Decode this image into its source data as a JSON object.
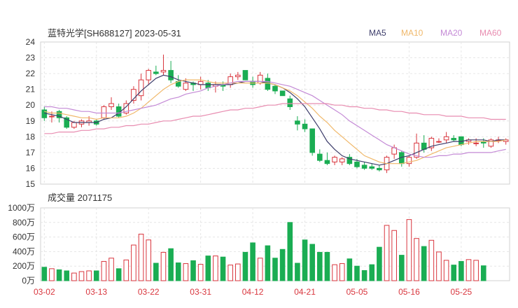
{
  "title": "蓝特光学[SH688127] 2023-05-31",
  "volume_title": "成交量 2071175",
  "colors": {
    "up": "#d9363e",
    "down": "#1aad53",
    "ma5": "#3d3d6b",
    "ma10": "#f0b86a",
    "ma20": "#c48ad6",
    "ma60": "#e88cb0"
  },
  "chart_data": [
    {
      "type": "candlestick",
      "title": "蓝特光学[SH688127] 2023-05-31",
      "ylim": [
        15,
        24
      ],
      "yticks": [
        15,
        16,
        17,
        18,
        19,
        20,
        21,
        22,
        23,
        24
      ],
      "x_labels": [
        "03-02",
        "03-13",
        "03-22",
        "03-31",
        "04-12",
        "04-21",
        "05-05",
        "05-16",
        "05-25"
      ],
      "x_label_index": [
        0,
        7,
        14,
        21,
        28,
        35,
        42,
        49,
        56
      ],
      "legend": [
        "MA5",
        "MA10",
        "MA20",
        "MA60"
      ],
      "candles": [
        {
          "o": 19.7,
          "h": 19.9,
          "l": 19.0,
          "c": 19.2
        },
        {
          "o": 19.3,
          "h": 19.6,
          "l": 18.9,
          "c": 19.3
        },
        {
          "o": 19.6,
          "h": 19.7,
          "l": 18.9,
          "c": 19.2
        },
        {
          "o": 19.2,
          "h": 19.3,
          "l": 18.5,
          "c": 18.6
        },
        {
          "o": 18.6,
          "h": 19.0,
          "l": 18.5,
          "c": 18.9
        },
        {
          "o": 18.8,
          "h": 19.1,
          "l": 18.6,
          "c": 19.0
        },
        {
          "o": 18.9,
          "h": 19.3,
          "l": 18.7,
          "c": 19.0
        },
        {
          "o": 19.0,
          "h": 19.1,
          "l": 18.7,
          "c": 18.8
        },
        {
          "o": 19.2,
          "h": 20.0,
          "l": 19.1,
          "c": 19.9
        },
        {
          "o": 19.9,
          "h": 20.5,
          "l": 19.7,
          "c": 20.1
        },
        {
          "o": 19.9,
          "h": 20.1,
          "l": 19.2,
          "c": 19.3
        },
        {
          "o": 19.5,
          "h": 20.3,
          "l": 19.4,
          "c": 20.1
        },
        {
          "o": 20.3,
          "h": 21.2,
          "l": 20.1,
          "c": 21.0
        },
        {
          "o": 20.6,
          "h": 22.0,
          "l": 20.3,
          "c": 21.6
        },
        {
          "o": 21.6,
          "h": 22.3,
          "l": 21.3,
          "c": 22.2
        },
        {
          "o": 22.1,
          "h": 22.5,
          "l": 21.9,
          "c": 22.0
        },
        {
          "o": 22.1,
          "h": 23.2,
          "l": 21.9,
          "c": 22.2
        },
        {
          "o": 22.2,
          "h": 22.8,
          "l": 21.4,
          "c": 21.6
        },
        {
          "o": 21.5,
          "h": 21.9,
          "l": 21.1,
          "c": 21.2
        },
        {
          "o": 21.0,
          "h": 21.7,
          "l": 20.9,
          "c": 21.4
        },
        {
          "o": 21.4,
          "h": 21.5,
          "l": 20.9,
          "c": 21.3
        },
        {
          "o": 21.3,
          "h": 21.8,
          "l": 21.0,
          "c": 21.5
        },
        {
          "o": 21.4,
          "h": 21.6,
          "l": 20.9,
          "c": 21.1
        },
        {
          "o": 21.2,
          "h": 21.5,
          "l": 20.8,
          "c": 21.3
        },
        {
          "o": 21.3,
          "h": 21.5,
          "l": 20.9,
          "c": 21.2
        },
        {
          "o": 21.3,
          "h": 22.0,
          "l": 21.1,
          "c": 21.8
        },
        {
          "o": 21.8,
          "h": 22.1,
          "l": 21.6,
          "c": 21.9
        },
        {
          "o": 22.2,
          "h": 22.2,
          "l": 21.6,
          "c": 21.6
        },
        {
          "o": 21.5,
          "h": 21.8,
          "l": 21.1,
          "c": 21.3
        },
        {
          "o": 21.4,
          "h": 22.1,
          "l": 21.3,
          "c": 21.9
        },
        {
          "o": 21.7,
          "h": 22.0,
          "l": 20.9,
          "c": 21.0
        },
        {
          "o": 21.2,
          "h": 21.3,
          "l": 20.7,
          "c": 20.9
        },
        {
          "o": 20.9,
          "h": 20.9,
          "l": 20.6,
          "c": 20.6
        },
        {
          "o": 20.4,
          "h": 20.6,
          "l": 19.7,
          "c": 19.9
        },
        {
          "o": 19.0,
          "h": 19.3,
          "l": 18.4,
          "c": 18.8
        },
        {
          "o": 18.8,
          "h": 19.1,
          "l": 18.3,
          "c": 18.5
        },
        {
          "o": 18.5,
          "h": 18.5,
          "l": 16.8,
          "c": 17.0
        },
        {
          "o": 16.9,
          "h": 17.2,
          "l": 16.4,
          "c": 16.5
        },
        {
          "o": 16.5,
          "h": 17.0,
          "l": 16.2,
          "c": 16.3
        },
        {
          "o": 16.4,
          "h": 16.8,
          "l": 16.2,
          "c": 16.7
        },
        {
          "o": 16.4,
          "h": 16.7,
          "l": 16.2,
          "c": 16.6
        },
        {
          "o": 16.7,
          "h": 16.9,
          "l": 16.2,
          "c": 16.3
        },
        {
          "o": 16.4,
          "h": 16.6,
          "l": 16.0,
          "c": 16.1
        },
        {
          "o": 16.2,
          "h": 16.4,
          "l": 15.9,
          "c": 16.0
        },
        {
          "o": 16.1,
          "h": 16.3,
          "l": 15.9,
          "c": 16.0
        },
        {
          "o": 16.0,
          "h": 16.2,
          "l": 15.8,
          "c": 15.9
        },
        {
          "o": 15.9,
          "h": 16.8,
          "l": 15.7,
          "c": 16.7
        },
        {
          "o": 16.9,
          "h": 17.5,
          "l": 16.6,
          "c": 17.3
        },
        {
          "o": 17.0,
          "h": 17.1,
          "l": 16.1,
          "c": 16.3
        },
        {
          "o": 16.3,
          "h": 16.8,
          "l": 16.1,
          "c": 16.7
        },
        {
          "o": 16.7,
          "h": 18.2,
          "l": 16.6,
          "c": 17.6
        },
        {
          "o": 17.6,
          "h": 18.1,
          "l": 17.0,
          "c": 17.2
        },
        {
          "o": 17.3,
          "h": 18.0,
          "l": 17.1,
          "c": 17.9
        },
        {
          "o": 17.7,
          "h": 17.9,
          "l": 17.6,
          "c": 17.7
        },
        {
          "o": 17.8,
          "h": 18.3,
          "l": 17.6,
          "c": 18.0
        },
        {
          "o": 17.9,
          "h": 18.1,
          "l": 17.7,
          "c": 17.8
        },
        {
          "o": 18.0,
          "h": 18.0,
          "l": 17.4,
          "c": 17.5
        },
        {
          "o": 17.7,
          "h": 17.9,
          "l": 17.5,
          "c": 17.8
        },
        {
          "o": 17.6,
          "h": 17.9,
          "l": 17.4,
          "c": 17.6
        },
        {
          "o": 17.7,
          "h": 17.9,
          "l": 17.3,
          "c": 17.6
        },
        {
          "o": 17.4,
          "h": 17.9,
          "l": 17.3,
          "c": 17.8
        },
        {
          "o": 17.8,
          "h": 18.0,
          "l": 17.6,
          "c": 17.8
        },
        {
          "o": 17.7,
          "h": 17.9,
          "l": 17.5,
          "c": 17.8
        }
      ],
      "series": [
        {
          "name": "MA5",
          "values": [
            19.5,
            19.4,
            19.3,
            19.1,
            18.9,
            18.9,
            18.9,
            18.9,
            19.1,
            19.2,
            19.5,
            19.9,
            20.4,
            20.9,
            21.3,
            21.7,
            21.9,
            21.8,
            21.6,
            21.5,
            21.4,
            21.3,
            21.3,
            21.3,
            21.3,
            21.3,
            21.4,
            21.5,
            21.5,
            21.5,
            21.4,
            21.3,
            21.1,
            20.8,
            20.4,
            19.9,
            19.2,
            18.5,
            17.7,
            17.2,
            16.8,
            16.6,
            16.5,
            16.4,
            16.3,
            16.2,
            16.3,
            16.5,
            16.7,
            16.8,
            17.0,
            17.2,
            17.4,
            17.5,
            17.6,
            17.7,
            17.7,
            17.8,
            17.8,
            17.8,
            17.7,
            17.8,
            17.8
          ]
        },
        {
          "name": "MA10",
          "values": [
            19.6,
            19.5,
            19.5,
            19.4,
            19.3,
            19.2,
            19.2,
            19.1,
            19.2,
            19.2,
            19.2,
            19.3,
            19.5,
            19.8,
            20.2,
            20.6,
            21.0,
            21.3,
            21.5,
            21.6,
            21.6,
            21.6,
            21.5,
            21.4,
            21.4,
            21.4,
            21.4,
            21.4,
            21.4,
            21.4,
            21.4,
            21.3,
            21.1,
            20.9,
            20.6,
            20.2,
            19.8,
            19.3,
            18.9,
            18.4,
            18.0,
            17.6,
            17.2,
            16.8,
            16.6,
            16.4,
            16.3,
            16.3,
            16.3,
            16.4,
            16.5,
            16.7,
            16.9,
            17.1,
            17.3,
            17.4,
            17.5,
            17.6,
            17.7,
            17.7,
            17.7,
            17.7,
            17.8
          ]
        },
        {
          "name": "MA20",
          "values": [
            19.9,
            19.9,
            19.8,
            19.8,
            19.7,
            19.6,
            19.6,
            19.5,
            19.5,
            19.5,
            19.5,
            19.6,
            19.7,
            19.8,
            19.9,
            20.0,
            20.2,
            20.4,
            20.5,
            20.7,
            20.8,
            20.9,
            21.1,
            21.2,
            21.3,
            21.4,
            21.5,
            21.5,
            21.5,
            21.5,
            21.5,
            21.4,
            21.3,
            21.2,
            21.0,
            20.8,
            20.6,
            20.3,
            20.0,
            19.7,
            19.4,
            19.0,
            18.7,
            18.4,
            18.1,
            17.8,
            17.5,
            17.3,
            17.1,
            16.9,
            16.8,
            16.7,
            16.7,
            16.8,
            16.8,
            16.9,
            16.9,
            17.0,
            17.0,
            17.0,
            17.0,
            17.1,
            17.2
          ]
        },
        {
          "name": "MA60",
          "values": [
            18.2,
            18.2,
            18.3,
            18.3,
            18.3,
            18.4,
            18.4,
            18.5,
            18.5,
            18.6,
            18.6,
            18.7,
            18.7,
            18.8,
            18.8,
            18.9,
            19.0,
            19.0,
            19.1,
            19.2,
            19.3,
            19.3,
            19.4,
            19.5,
            19.6,
            19.7,
            19.7,
            19.8,
            19.8,
            19.9,
            20.0,
            20.0,
            20.1,
            20.1,
            20.1,
            20.1,
            20.1,
            20.1,
            20.1,
            20.0,
            20.0,
            19.9,
            19.9,
            19.8,
            19.8,
            19.7,
            19.7,
            19.6,
            19.6,
            19.5,
            19.5,
            19.4,
            19.4,
            19.4,
            19.3,
            19.3,
            19.3,
            19.2,
            19.2,
            19.2,
            19.1,
            19.1,
            19.1
          ]
        }
      ]
    },
    {
      "type": "bar",
      "title": "成交量 2071175",
      "ylim": [
        0,
        1000
      ],
      "yticks": [
        0,
        200,
        400,
        600,
        800,
        1000
      ],
      "ytick_labels": [
        "0万",
        "200万",
        "400万",
        "600万",
        "800万",
        "1000万"
      ],
      "values": [
        185,
        165,
        150,
        135,
        105,
        125,
        135,
        135,
        265,
        310,
        165,
        285,
        490,
        640,
        560,
        240,
        390,
        440,
        245,
        235,
        275,
        225,
        340,
        340,
        325,
        215,
        230,
        390,
        520,
        310,
        480,
        310,
        430,
        800,
        240,
        560,
        500,
        390,
        390,
        220,
        235,
        300,
        200,
        140,
        220,
        460,
        760,
        690,
        350,
        840,
        580,
        470,
        555,
        395,
        280,
        215,
        265,
        290,
        280,
        205
      ]
    }
  ]
}
